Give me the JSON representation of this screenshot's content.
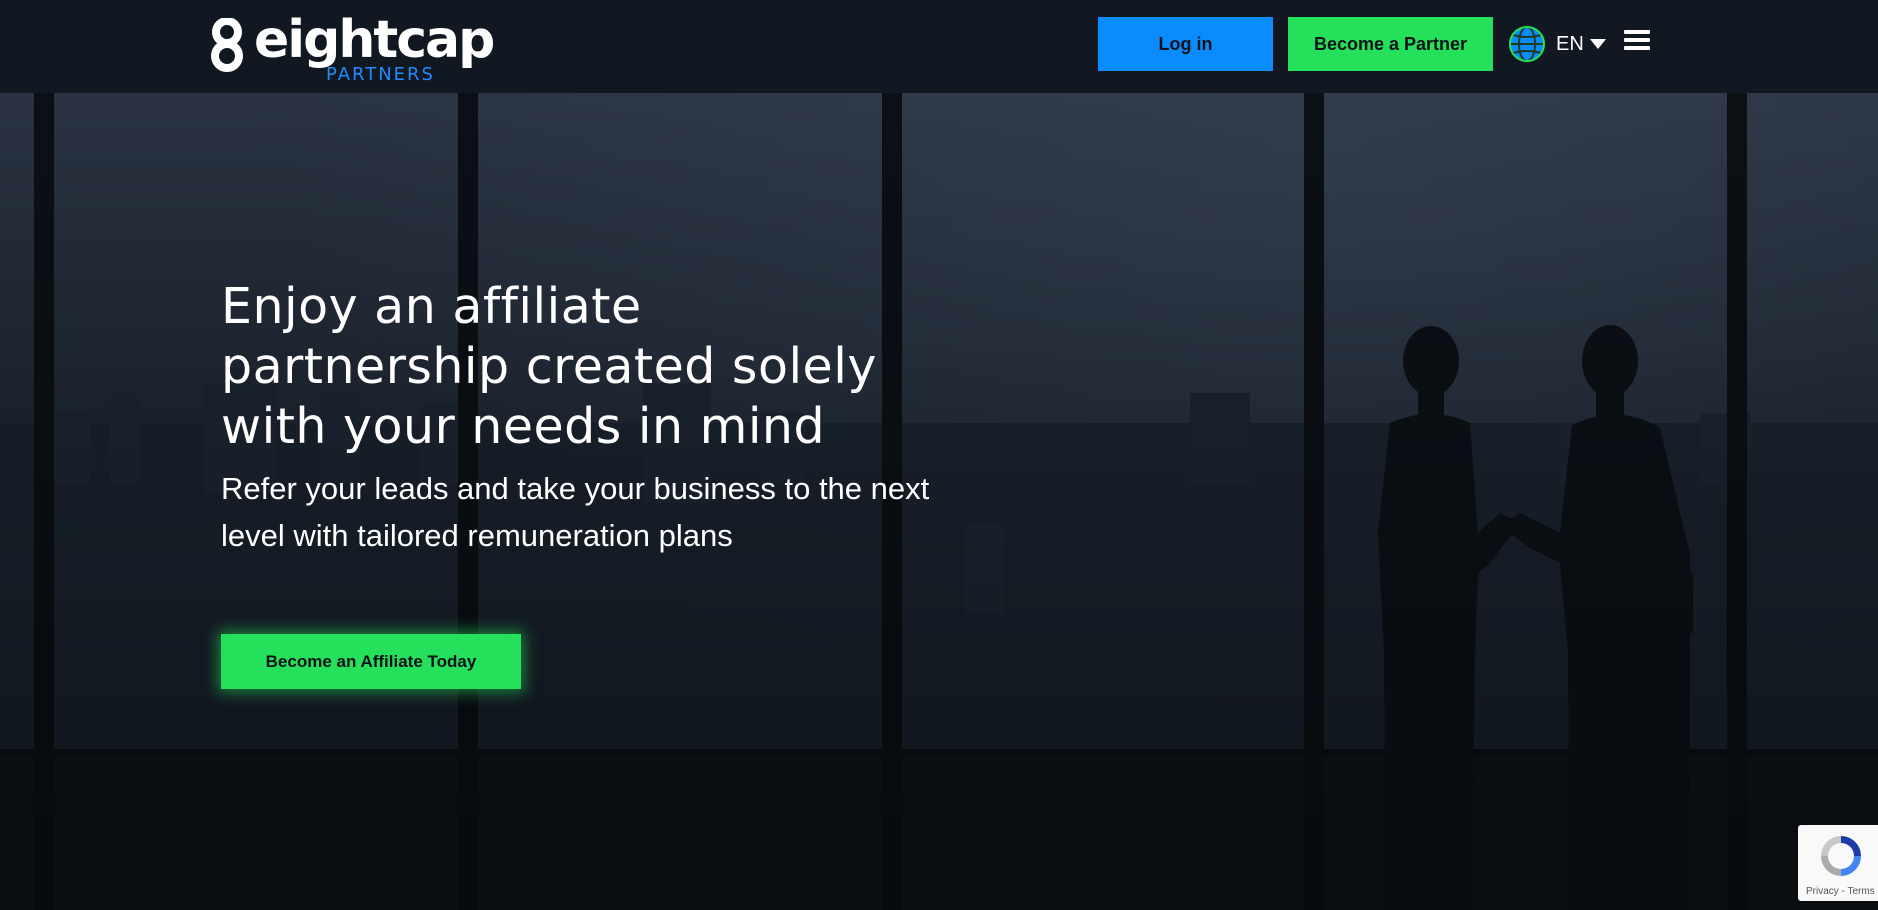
{
  "header": {
    "logo": {
      "wordmark": "eightcap",
      "sub": "PARTNERS"
    },
    "login_label": "Log in",
    "partner_label": "Become a Partner",
    "language": "EN"
  },
  "hero": {
    "title": "Enjoy an affiliate partnership created solely with your needs in mind",
    "subtitle": "Refer your leads and take your business to the next level with tailored remuneration plans",
    "cta_label": "Become an Affiliate Today"
  },
  "recaptcha": {
    "links": "Privacy - Terms"
  },
  "colors": {
    "header_bg": "#111821",
    "brand_blue": "#0a8cff",
    "brand_green": "#25e05a",
    "hero_text": "#ffffff"
  },
  "icons": [
    "globe-icon",
    "chevron-down-icon",
    "hamburger-menu-icon",
    "recaptcha-icon"
  ]
}
